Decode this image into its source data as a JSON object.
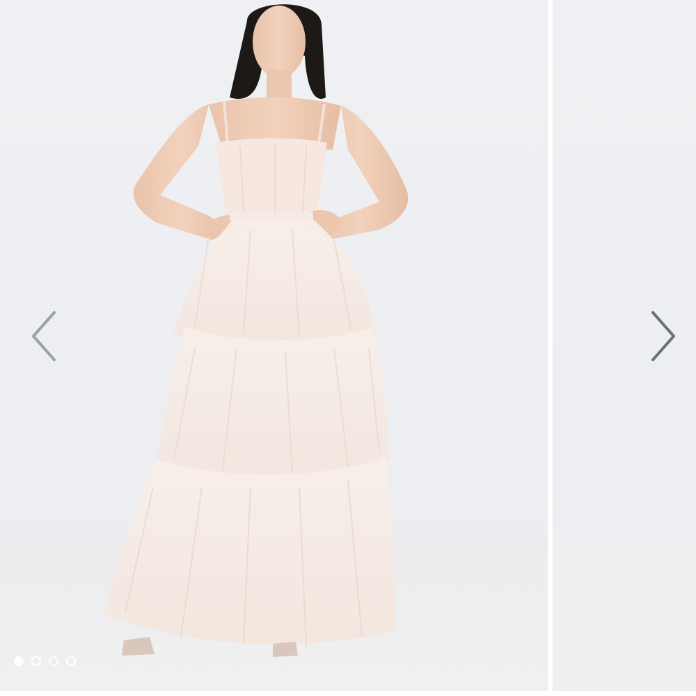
{
  "carousel": {
    "images": [
      {
        "icon": "model-in-tiered-tulle-gown-image"
      },
      {
        "icon": "next-slide-preview-image"
      }
    ],
    "prev_icon": "chevron-left-icon",
    "next_icon": "chevron-right-icon",
    "dots": [
      {
        "state": "active"
      },
      {
        "state": "inactive"
      },
      {
        "state": "inactive"
      },
      {
        "state": "inactive"
      }
    ],
    "current_index": 1,
    "total": 4
  },
  "colors": {
    "background": "#eef0f3",
    "dress": "#f6ece6",
    "arrow_prev": "#9aa0a6",
    "arrow_next": "#6b7075",
    "dot": "#ffffff"
  }
}
